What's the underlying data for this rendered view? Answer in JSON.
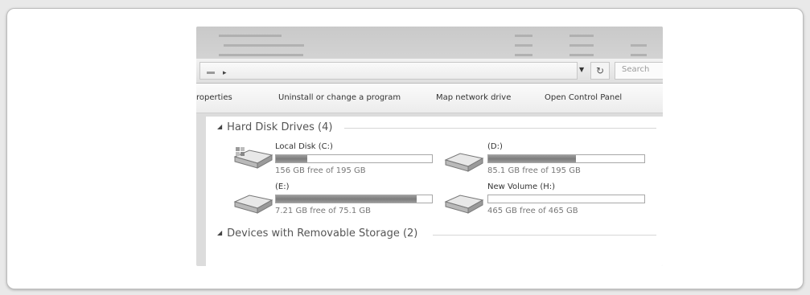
{
  "address_bar": {
    "refresh_icon": "refresh-icon",
    "search_placeholder": "Search"
  },
  "toolbar": {
    "items": [
      "roperties",
      "Uninstall or change a program",
      "Map network drive",
      "Open Control Panel"
    ]
  },
  "groups": [
    {
      "title": "Hard Disk Drives (4)",
      "drives": [
        {
          "name": "Local Disk (C:)",
          "free_text": "156 GB free of 195 GB",
          "used_fraction": 0.2
        },
        {
          "name": "(D:)",
          "free_text": "85.1 GB free of 195 GB",
          "used_fraction": 0.56
        },
        {
          "name": "(E:)",
          "free_text": "7.21 GB free of 75.1 GB",
          "used_fraction": 0.9
        },
        {
          "name": "New Volume (H:)",
          "free_text": "465 GB free of 465 GB",
          "used_fraction": 0.0
        }
      ]
    },
    {
      "title": "Devices with Removable Storage (2)",
      "drives": []
    }
  ],
  "colors": {
    "bar_fill": "#8a8a8a",
    "window_bg": "#dcdcdc"
  }
}
